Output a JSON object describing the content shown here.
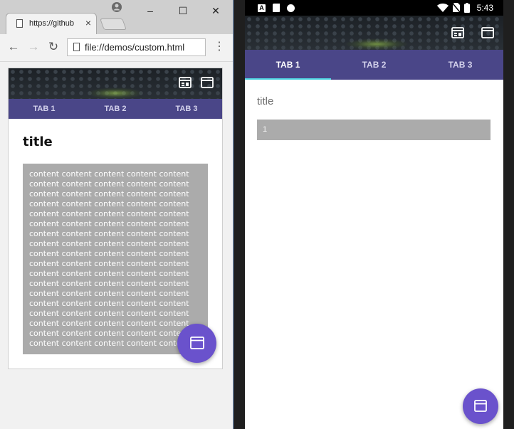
{
  "browser": {
    "tab_title": "https://github",
    "tab_close": "×",
    "window_controls": {
      "minimize": "–",
      "maximize": "☐",
      "close": "✕"
    },
    "nav": {
      "back": "←",
      "forward": "→",
      "reload": "↻",
      "menu": "⋮"
    },
    "address_url": "file://demos/custom.html"
  },
  "app_left": {
    "tabs": [
      {
        "label": "TAB 1"
      },
      {
        "label": "TAB 2"
      },
      {
        "label": "TAB 3"
      }
    ],
    "title": "title",
    "content_lines": [
      "content content content content content",
      "content content content content content",
      "content content content content content",
      "content content content content content",
      "content content content content content",
      "content content content content content",
      "content content content content content",
      "content content content content content",
      "content content content content content",
      "content content content content content",
      "content content content content content",
      "content content content content content",
      "content content content content content",
      "content content content content content",
      "content content content content content",
      "content content content content content",
      "content content content content content",
      "content content content content content"
    ]
  },
  "phone": {
    "status": {
      "time": "5:43",
      "left_icons": [
        "A",
        "sd-card-icon",
        "record-icon"
      ],
      "right_icons": [
        "wifi-icon",
        "no-sim-icon",
        "battery-icon"
      ]
    },
    "tabs": [
      {
        "label": "TAB 1"
      },
      {
        "label": "TAB 2"
      },
      {
        "label": "TAB 3"
      }
    ],
    "title": "title",
    "field_value": "1"
  },
  "colors": {
    "tab_bar": "#4a4688",
    "fab": "#6a52cc",
    "indicator": "#4dd2e0",
    "content_block": "#ababab"
  }
}
